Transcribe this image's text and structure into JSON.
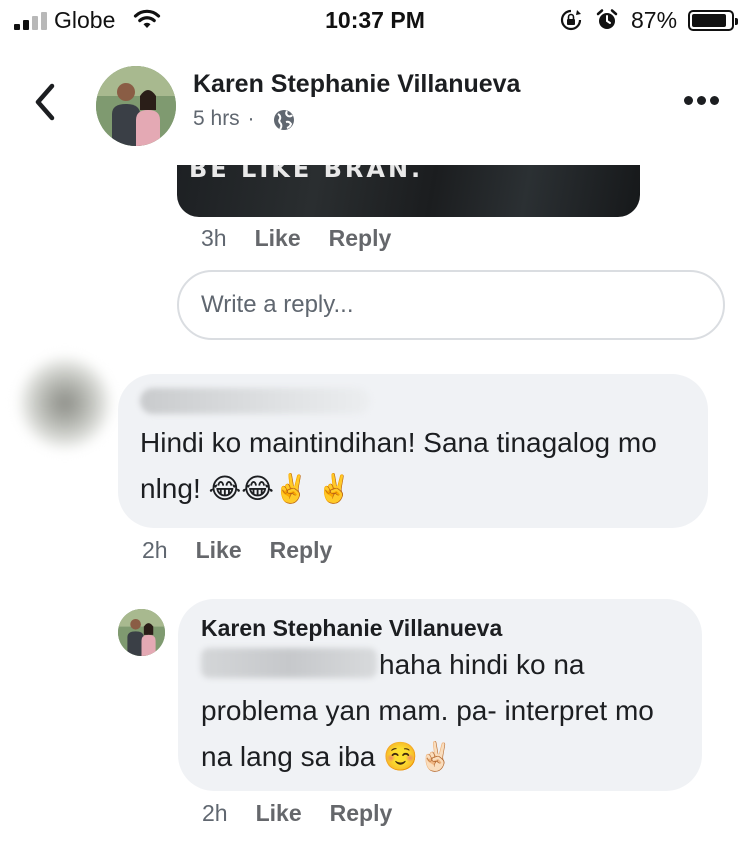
{
  "status_bar": {
    "carrier": "Globe",
    "time": "10:37 PM",
    "battery": "87%",
    "battery_level": 0.87
  },
  "header": {
    "name": "Karen Stephanie Villanueva",
    "time_ago": "5 hrs",
    "separator": "·",
    "icons": {
      "back": "chevron-left-icon",
      "privacy": "globe-icon",
      "more": "more-dots-icon"
    }
  },
  "previous_comment": {
    "image_caption": "BE LIKE BRAN.",
    "time": "3h",
    "like": "Like",
    "reply": "Reply"
  },
  "reply_box": {
    "placeholder": "Write a reply..."
  },
  "comments": [
    {
      "author_blurred": true,
      "text": "Hindi ko maintindihan! Sana tinagalog mo nlng! 😂😂✌️ ✌️",
      "time": "2h",
      "like": "Like",
      "reply": "Reply"
    },
    {
      "author": "Karen Stephanie Villanueva",
      "mention_blurred": true,
      "text": "haha hindi ko na problema yan mam. pa- interpret mo na lang sa iba ☺️✌🏻",
      "time": "2h",
      "like": "Like",
      "reply": "Reply"
    }
  ],
  "colors": {
    "bubble_bg": "#f0f2f5",
    "secondary_text": "#606770",
    "primary_text": "#1c1e21",
    "input_border": "#dadde1"
  }
}
